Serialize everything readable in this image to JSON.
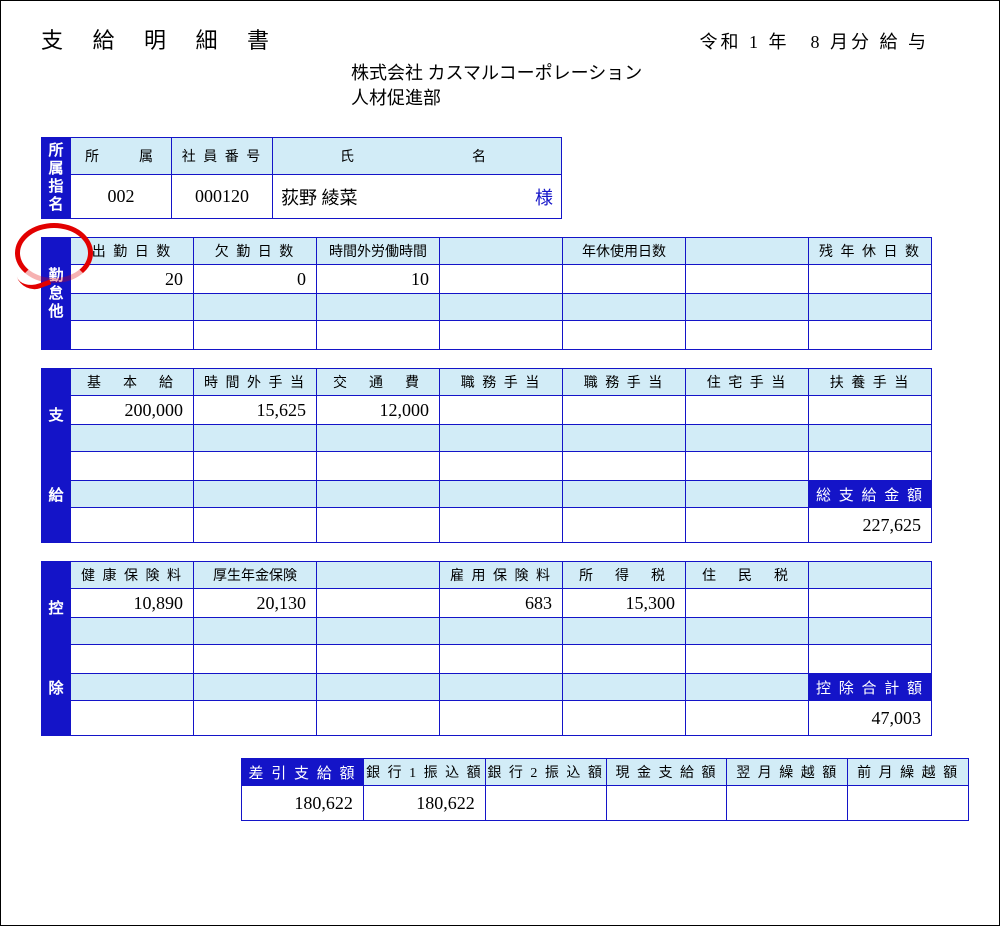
{
  "header": {
    "title": "支 給 明 細 書",
    "period": "令和 1 年　8 月分 給 与",
    "company_line1": "株式会社 カスマルコーポレーション",
    "company_line2": "人材促進部"
  },
  "info": {
    "slab": "所属指名",
    "headers": {
      "dept": "所　　属",
      "empno": "社 員 番 号",
      "name": "氏　　　　　名"
    },
    "dept": "002",
    "empno": "000120",
    "name": "荻野 綾菜",
    "sama": "様"
  },
  "attendance": {
    "slab": "勤怠他",
    "headers": [
      "出 勤 日 数",
      "欠 勤 日 数",
      "時間外労働時間",
      "",
      "年休使用日数",
      "",
      "残 年 休 日 数"
    ],
    "row1": [
      "20",
      "0",
      "10",
      "",
      "",
      "",
      ""
    ]
  },
  "payment": {
    "slab1": "支",
    "slab2": "給",
    "headers": [
      "基　本　給",
      "時 間 外 手 当",
      "交　通　費",
      "職 務 手 当",
      "職 務 手 当",
      "住 宅 手 当",
      "扶 養 手 当"
    ],
    "row1": [
      "200,000",
      "15,625",
      "12,000",
      "",
      "",
      "",
      ""
    ],
    "total_label": "総 支 給 金 額",
    "total": "227,625"
  },
  "deduction": {
    "slab1": "控",
    "slab2": "除",
    "headers": [
      "健 康 保 険 料",
      "厚生年金保険",
      "",
      "雇 用 保 険 料",
      "所　得　税",
      "住　民　税",
      ""
    ],
    "row1": [
      "10,890",
      "20,130",
      "",
      "683",
      "15,300",
      "",
      ""
    ],
    "total_label": "控 除 合 計 額",
    "total": "47,003"
  },
  "net": {
    "headers": [
      "差 引 支 給 額",
      "銀 行 1 振 込 額",
      "銀 行 2 振 込 額",
      "現 金 支 給 額",
      "翌 月 繰 越 額",
      "前 月 繰 越 額"
    ],
    "row1": [
      "180,622",
      "180,622",
      "",
      "",
      "",
      ""
    ]
  }
}
